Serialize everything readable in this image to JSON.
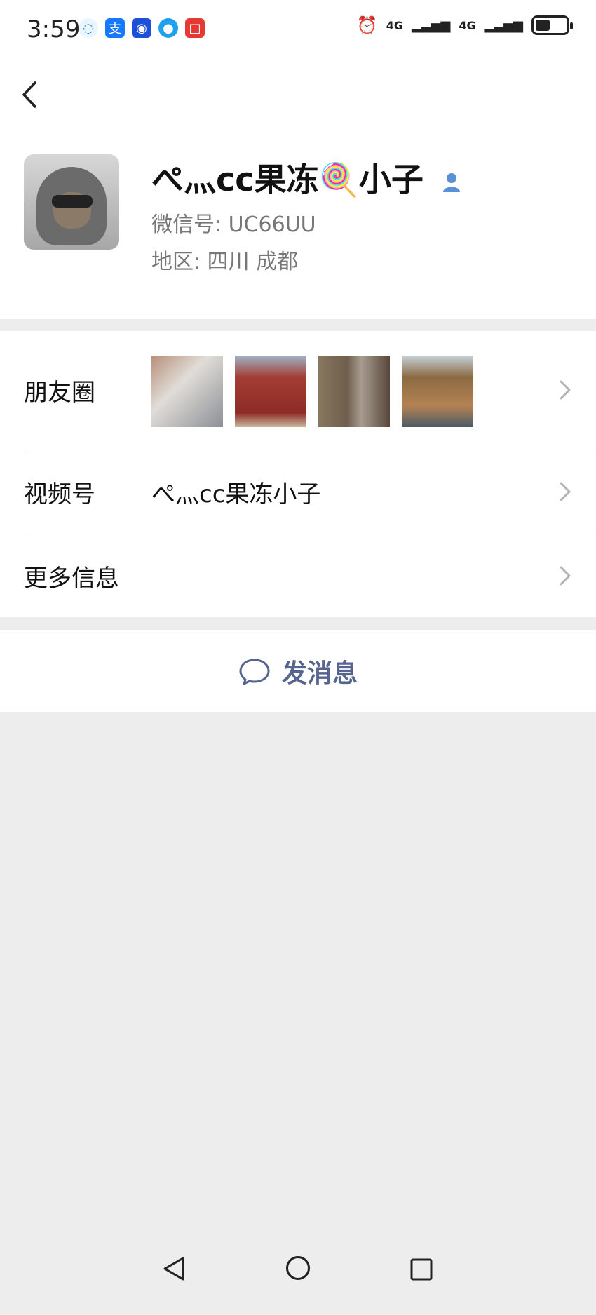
{
  "status_bar": {
    "time": "3:59",
    "net1": "4G",
    "net2": "4G",
    "icons": [
      "bubble-icon",
      "alipay-icon",
      "lightbulb-icon",
      "globe-icon",
      "red-app-icon",
      "alarm-icon",
      "signal-icon",
      "battery-icon"
    ]
  },
  "profile": {
    "name_part1": "ぺ灬cc果冻",
    "lollipop": "🍭",
    "name_part2": "小子",
    "wechat_id": "微信号:  UC66UU",
    "region": "地区:  四川  成都"
  },
  "rows": {
    "moments_label": "朋友圈",
    "channels_label": "视频号",
    "channels_value": "ぺ灬cc果冻小子",
    "more_label": "更多信息"
  },
  "actions": {
    "send_message": "发消息"
  },
  "colors": {
    "accent_text": "#56658f",
    "bg": "#ededed",
    "avatar_badge": "#5b8fd6"
  }
}
